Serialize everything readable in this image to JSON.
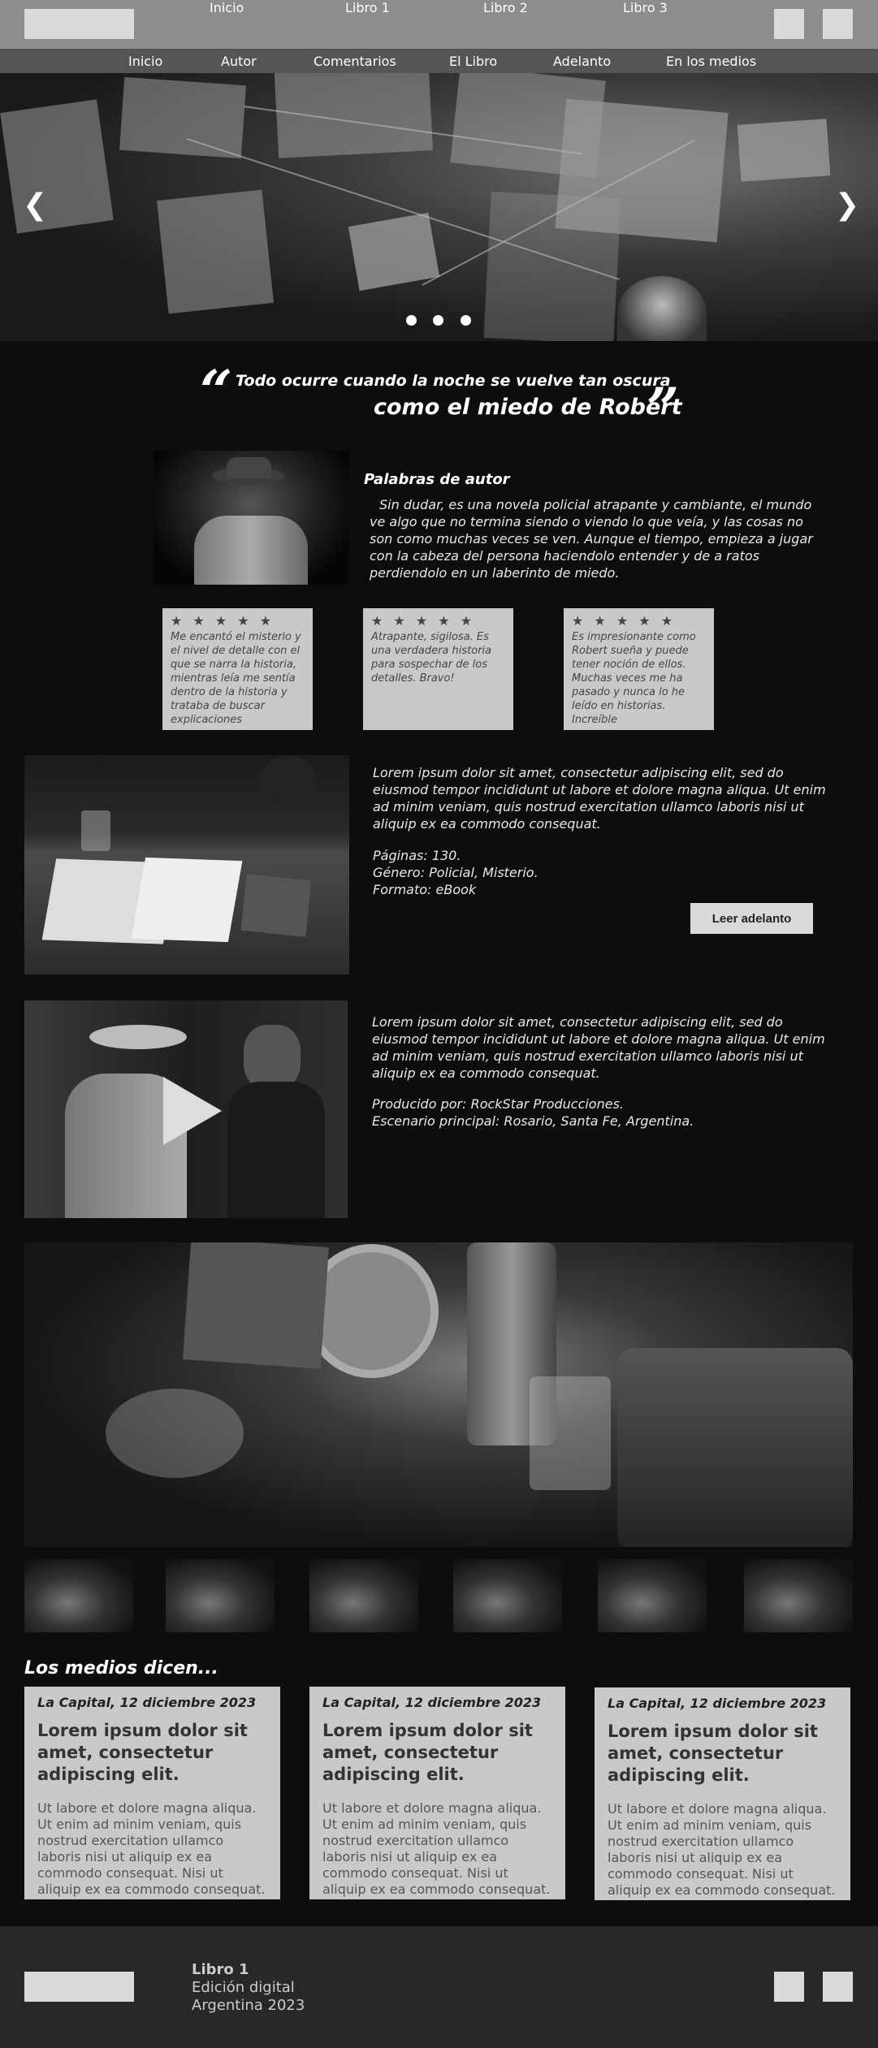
{
  "topnav": {
    "links": [
      "Inicio",
      "Libro 1",
      "Libro 2",
      "Libro 3"
    ]
  },
  "subnav": {
    "links": [
      "Inicio",
      "Autor",
      "Comentarios",
      "El Libro",
      "Adelanto",
      "En los medios"
    ]
  },
  "hero": {
    "prev_icon": "chevron-left-icon",
    "next_icon": "chevron-right-icon",
    "dots": 3
  },
  "quote": {
    "line1": "Todo ocurre cuando la noche se  vuelve tan oscura",
    "line2": "como el miedo de Robert"
  },
  "author": {
    "title": "Palabras de autor",
    "text": "Sin dudar, es una novela policial atrapante y cambiante, el mundo ve algo que no termina siendo o viendo lo que veía, y las cosas no son como muchas veces se ven. Aunque el tiempo, empieza a jugar con la cabeza del persona haciendolo entender y de a ratos perdiendolo en un laberinto de miedo."
  },
  "reviews": [
    {
      "stars": "★ ★ ★ ★ ★",
      "text": "Me encantó el misterio y el nivel de detalle con el que se narra la historia, mientras leía me sentía dentro de la historia y trataba de buscar explicaciones"
    },
    {
      "stars": "★ ★ ★ ★ ★",
      "text": "Atrapante, sigilosa. Es una verdadera historia para sospechar de los detalles. Bravo!"
    },
    {
      "stars": "★ ★ ★ ★ ★",
      "text": "Es impresionante como Robert sueña y puede tener noción de ellos. Muchas veces me ha pasado y nunca lo he leído en historias. Increíble"
    }
  ],
  "book": {
    "description": "Lorem ipsum dolor sit amet, consectetur adipiscing elit, sed do eiusmod tempor incididunt ut labore et dolore magna aliqua. Ut enim ad minim veniam, quis nostrud exercitation ullamco laboris nisi ut aliquip ex ea commodo consequat.",
    "pages": "Páginas: 130.",
    "genre": "Género: Policial, Misterio.",
    "format": "Formato: eBook",
    "read_button": "Leer adelanto"
  },
  "video": {
    "description": "Lorem ipsum dolor sit amet, consectetur adipiscing elit, sed do eiusmod tempor incididunt ut labore et dolore magna aliqua. Ut enim ad minim veniam, quis nostrud exercitation ullamco laboris nisi ut aliquip ex ea commodo consequat.",
    "producer": "Producido por: RockStar Producciones.",
    "location": "Escenario principal: Rosario, Santa Fe, Argentina.",
    "play_icon": "play-icon"
  },
  "media": {
    "title": "Los medios dicen...",
    "cards": [
      {
        "date": "La Capital, 12 diciembre 2023",
        "headline": "Lorem ipsum dolor sit amet, consectetur adipiscing elit.",
        "body": " Ut labore et dolore magna aliqua. Ut enim ad minim veniam, quis nostrud exercitation ullamco laboris nisi ut aliquip ex ea commodo consequat. Nisi ut aliquip ex ea commodo consequat."
      },
      {
        "date": "La Capital, 12 diciembre 2023",
        "headline": "Lorem ipsum dolor sit amet, consectetur adipiscing elit.",
        "body": " Ut labore et dolore magna aliqua. Ut enim ad minim veniam, quis nostrud exercitation ullamco laboris nisi ut aliquip ex ea commodo consequat. Nisi ut aliquip ex ea commodo consequat."
      },
      {
        "date": "La Capital, 12 diciembre 2023",
        "headline": "Lorem ipsum dolor sit amet, consectetur adipiscing elit.",
        "body": " Ut labore et dolore magna aliqua. Ut enim ad minim veniam, quis nostrud exercitation ullamco laboris nisi ut aliquip ex ea commodo consequat. Nisi ut aliquip ex ea commodo consequat."
      }
    ]
  },
  "footer": {
    "title": "Libro 1",
    "line2": "Edición digital",
    "line3": "Argentina 2023"
  },
  "colors": {
    "background": "#0d0d0d",
    "topnav": "#8d8d8d",
    "subnav": "#555555",
    "card": "#c9c9c9",
    "footer": "#282828"
  }
}
